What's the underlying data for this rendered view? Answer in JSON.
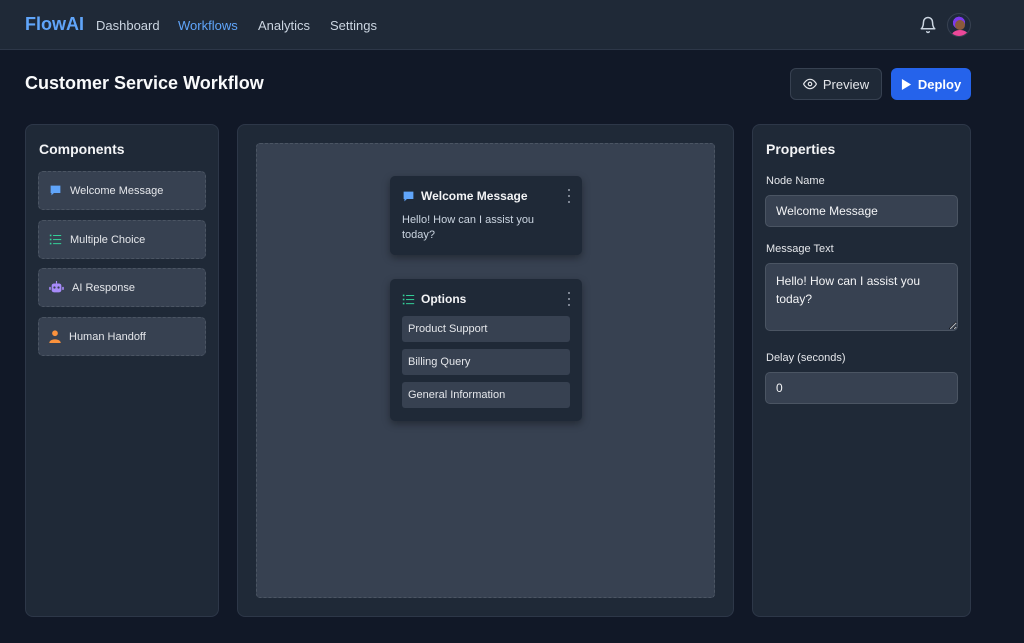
{
  "nav": {
    "brand": "FlowAI",
    "links": [
      {
        "label": "Dashboard",
        "active": false
      },
      {
        "label": "Workflows",
        "active": true
      },
      {
        "label": "Analytics",
        "active": false
      },
      {
        "label": "Settings",
        "active": false
      }
    ],
    "icons": [
      "bell-icon",
      "avatar"
    ]
  },
  "header": {
    "title": "Customer Service Workflow",
    "preview_label": "Preview",
    "deploy_label": "Deploy"
  },
  "components": {
    "title": "Components",
    "items": [
      {
        "label": "Welcome Message",
        "icon": "chat-bubble-icon",
        "color": "#60a5fa"
      },
      {
        "label": "Multiple Choice",
        "icon": "list-icon",
        "color": "#34d399"
      },
      {
        "label": "AI Response",
        "icon": "robot-icon",
        "color": "#a78bfa"
      },
      {
        "label": "Human Handoff",
        "icon": "person-icon",
        "color": "#fb923c"
      }
    ]
  },
  "canvas": {
    "welcome_node": {
      "title": "Welcome Message",
      "text": "Hello! How can I assist you today?"
    },
    "options_node": {
      "title": "Options",
      "options": [
        "Product Support",
        "Billing Query",
        "General Information"
      ]
    }
  },
  "properties": {
    "title": "Properties",
    "node_name_label": "Node Name",
    "node_name_value": "Welcome Message",
    "message_text_label": "Message Text",
    "message_text_value": "Hello! How can I assist you today?",
    "delay_label": "Delay (seconds)",
    "delay_value": "0"
  },
  "colors": {
    "accent": "#60a5fa",
    "primary_button": "#2563eb",
    "background": "#111827",
    "panel": "#1f2937"
  }
}
